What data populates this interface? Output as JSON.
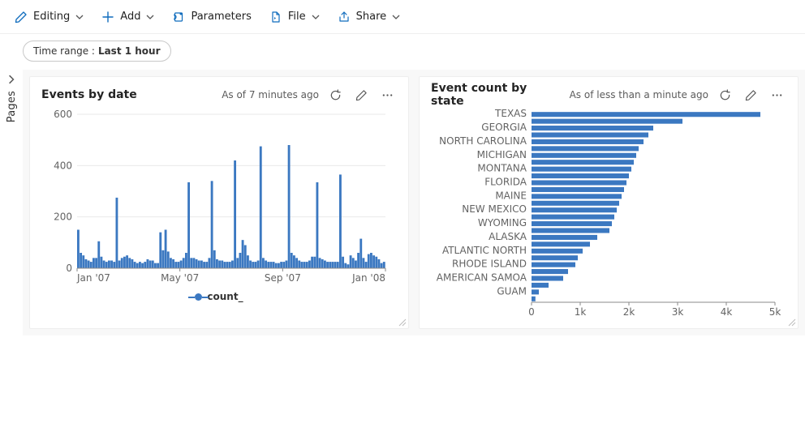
{
  "toolbar": {
    "editing": "Editing",
    "add": "Add",
    "parameters": "Parameters",
    "file": "File",
    "share": "Share"
  },
  "filter": {
    "label": "Time range :",
    "value": "Last 1 hour"
  },
  "sidebar": {
    "label": "Pages"
  },
  "panels": {
    "events": {
      "title": "Events by date",
      "status": "As of 7 minutes ago",
      "legend": "count_"
    },
    "bystate": {
      "title": "Event count by state",
      "status": "As of less than a minute ago"
    }
  },
  "chart_data": [
    {
      "type": "bar",
      "title": "Events by date",
      "xlabel": "",
      "ylabel": "",
      "ylim": [
        0,
        600
      ],
      "yticks": [
        0,
        200,
        400,
        600
      ],
      "xticks": [
        "Jan '07",
        "May '07",
        "Sep '07",
        "Jan '08"
      ],
      "series": [
        {
          "name": "count_",
          "values": [
            150,
            60,
            50,
            35,
            30,
            25,
            40,
            40,
            105,
            45,
            30,
            25,
            30,
            30,
            25,
            275,
            30,
            40,
            45,
            50,
            40,
            35,
            25,
            20,
            25,
            20,
            25,
            35,
            30,
            30,
            20,
            20,
            140,
            70,
            150,
            65,
            40,
            35,
            25,
            25,
            30,
            40,
            60,
            335,
            40,
            40,
            35,
            30,
            30,
            25,
            25,
            40,
            340,
            70,
            35,
            30,
            30,
            25,
            25,
            25,
            30,
            420,
            40,
            60,
            110,
            90,
            50,
            30,
            25,
            25,
            30,
            475,
            40,
            30,
            25,
            25,
            25,
            20,
            20,
            25,
            25,
            30,
            480,
            60,
            50,
            40,
            30,
            25,
            25,
            25,
            30,
            45,
            45,
            335,
            40,
            35,
            30,
            25,
            25,
            25,
            25,
            25,
            365,
            45,
            20,
            15,
            50,
            40,
            30,
            60,
            115,
            40,
            25,
            55,
            60,
            50,
            45,
            35,
            20,
            25
          ]
        }
      ]
    },
    {
      "type": "bar",
      "orientation": "horizontal",
      "title": "Event count by state",
      "xlabel": "",
      "ylabel": "",
      "xlim": [
        0,
        5000
      ],
      "xticks": [
        0,
        1000,
        2000,
        3000,
        4000,
        5000
      ],
      "categories": [
        "TEXAS",
        "",
        "GEORGIA",
        "",
        "NORTH CAROLINA",
        "",
        "MICHIGAN",
        "",
        "MONTANA",
        "",
        "FLORIDA",
        "",
        "MAINE",
        "",
        "NEW MEXICO",
        "",
        "WYOMING",
        "",
        "ALASKA",
        "",
        "ATLANTIC NORTH",
        "",
        "RHODE ISLAND",
        "",
        "AMERICAN SAMOA",
        "",
        "GUAM",
        ""
      ],
      "values": [
        4700,
        3100,
        2500,
        2400,
        2300,
        2200,
        2150,
        2100,
        2050,
        2000,
        1950,
        1900,
        1850,
        1800,
        1750,
        1700,
        1650,
        1600,
        1350,
        1200,
        1050,
        950,
        900,
        750,
        650,
        350,
        150,
        80
      ]
    }
  ]
}
